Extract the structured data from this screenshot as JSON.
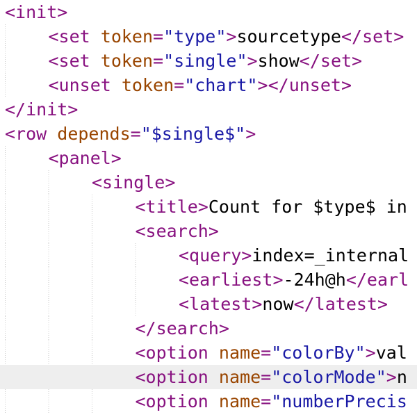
{
  "editor": {
    "lines": [
      {
        "indent": 0,
        "tokens": [
          {
            "t": "tag",
            "v": "<init>"
          }
        ]
      },
      {
        "indent": 1,
        "tokens": [
          {
            "t": "tag",
            "v": "<set "
          },
          {
            "t": "attr",
            "v": "token"
          },
          {
            "t": "eq",
            "v": "="
          },
          {
            "t": "str",
            "v": "\"type\""
          },
          {
            "t": "tag",
            "v": ">"
          },
          {
            "t": "txt",
            "v": "sourcetype"
          },
          {
            "t": "tag",
            "v": "</set>"
          }
        ]
      },
      {
        "indent": 1,
        "tokens": [
          {
            "t": "tag",
            "v": "<set "
          },
          {
            "t": "attr",
            "v": "token"
          },
          {
            "t": "eq",
            "v": "="
          },
          {
            "t": "str",
            "v": "\"single\""
          },
          {
            "t": "tag",
            "v": ">"
          },
          {
            "t": "txt",
            "v": "show"
          },
          {
            "t": "tag",
            "v": "</set>"
          }
        ]
      },
      {
        "indent": 1,
        "tokens": [
          {
            "t": "tag",
            "v": "<unset "
          },
          {
            "t": "attr",
            "v": "token"
          },
          {
            "t": "eq",
            "v": "="
          },
          {
            "t": "str",
            "v": "\"chart\""
          },
          {
            "t": "tag",
            "v": "></unset>"
          }
        ]
      },
      {
        "indent": 0,
        "tokens": [
          {
            "t": "tag",
            "v": "</init>"
          }
        ]
      },
      {
        "indent": 0,
        "tokens": [
          {
            "t": "tag",
            "v": "<row "
          },
          {
            "t": "attr",
            "v": "depends"
          },
          {
            "t": "eq",
            "v": "="
          },
          {
            "t": "str",
            "v": "\"$single$\""
          },
          {
            "t": "tag",
            "v": ">"
          }
        ]
      },
      {
        "indent": 1,
        "tokens": [
          {
            "t": "tag",
            "v": "<panel>"
          }
        ]
      },
      {
        "indent": 2,
        "tokens": [
          {
            "t": "tag",
            "v": "<single>"
          }
        ]
      },
      {
        "indent": 3,
        "tokens": [
          {
            "t": "tag",
            "v": "<title>"
          },
          {
            "t": "txt",
            "v": "Count for $type$ in"
          }
        ]
      },
      {
        "indent": 3,
        "tokens": [
          {
            "t": "tag",
            "v": "<search>"
          }
        ]
      },
      {
        "indent": 4,
        "tokens": [
          {
            "t": "tag",
            "v": "<query>"
          },
          {
            "t": "txt",
            "v": "index=_internal"
          }
        ]
      },
      {
        "indent": 4,
        "tokens": [
          {
            "t": "tag",
            "v": "<earliest>"
          },
          {
            "t": "txt",
            "v": "-24h@h"
          },
          {
            "t": "tag",
            "v": "</earl"
          }
        ]
      },
      {
        "indent": 4,
        "tokens": [
          {
            "t": "tag",
            "v": "<latest>"
          },
          {
            "t": "txt",
            "v": "now"
          },
          {
            "t": "tag",
            "v": "</latest>"
          }
        ]
      },
      {
        "indent": 3,
        "tokens": [
          {
            "t": "tag",
            "v": "</search>"
          }
        ]
      },
      {
        "indent": 3,
        "tokens": [
          {
            "t": "tag",
            "v": "<option "
          },
          {
            "t": "attr",
            "v": "name"
          },
          {
            "t": "eq",
            "v": "="
          },
          {
            "t": "str",
            "v": "\"colorBy\""
          },
          {
            "t": "tag",
            "v": ">"
          },
          {
            "t": "txt",
            "v": "val"
          }
        ]
      },
      {
        "indent": 3,
        "highlight": true,
        "tokens": [
          {
            "t": "tag",
            "v": "<option "
          },
          {
            "t": "attr",
            "v": "name"
          },
          {
            "t": "eq",
            "v": "="
          },
          {
            "t": "str",
            "v": "\"colorMode\""
          },
          {
            "t": "tag",
            "v": ">"
          },
          {
            "t": "txt",
            "v": "n"
          }
        ]
      },
      {
        "indent": 3,
        "tokens": [
          {
            "t": "tag",
            "v": "<option "
          },
          {
            "t": "attr",
            "v": "name"
          },
          {
            "t": "eq",
            "v": "="
          },
          {
            "t": "str",
            "v": "\"numberPrecis"
          }
        ]
      }
    ]
  },
  "colors": {
    "tag": "#881280",
    "attribute": "#994500",
    "string": "#1a1aa6",
    "text": "#000000",
    "highlight_line": "#eeeeee",
    "indent_guide": "#c8c8c8"
  }
}
